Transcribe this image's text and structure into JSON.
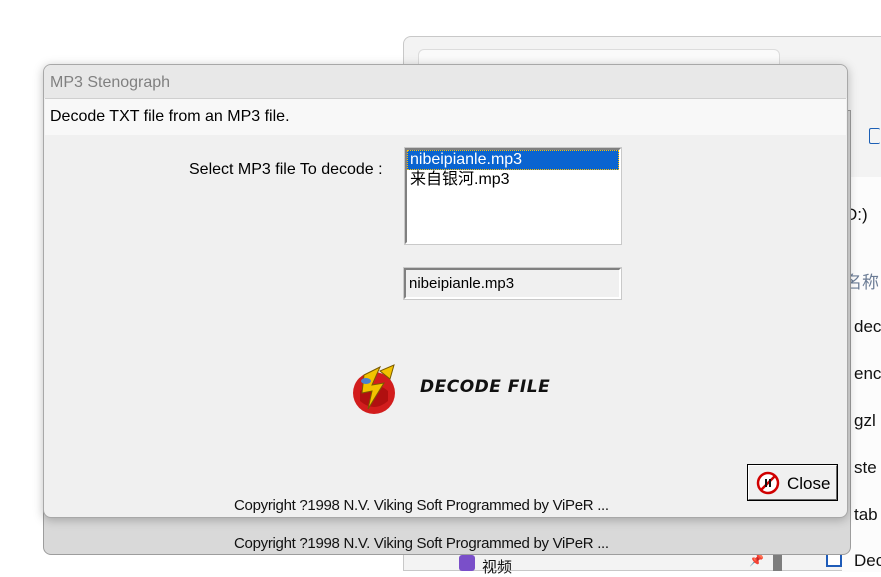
{
  "background_window": {
    "side_items": [
      "D:)",
      "名称",
      "dec",
      "enc",
      "gzl",
      "ste",
      "tab",
      "Dec"
    ],
    "bottom_item": "视频"
  },
  "dialog": {
    "title": "MP3 Stenograph",
    "description": "Decode TXT file from an MP3 file.",
    "select_label": "Select MP3 file To decode :",
    "files": [
      {
        "name": "nibeipianle.mp3",
        "selected": true
      },
      {
        "name": "来自银河.mp3",
        "selected": false
      }
    ],
    "selected_file": "nibeipianle.mp3",
    "decode_button_label": "DECODE FILE",
    "close_button_label": "Close",
    "copyright": "Copyright ?1998 N.V. Viking Soft   Programmed by ViPeR ..."
  },
  "colors": {
    "selection": "#0a64d0",
    "dialog_bg": "#f0f0f0",
    "decode_icon_red": "#d21d1d",
    "decode_icon_yellow": "#f2c200"
  },
  "icons": {
    "decode": "decode-shield-lightning-icon",
    "close": "prohibited-icon"
  }
}
